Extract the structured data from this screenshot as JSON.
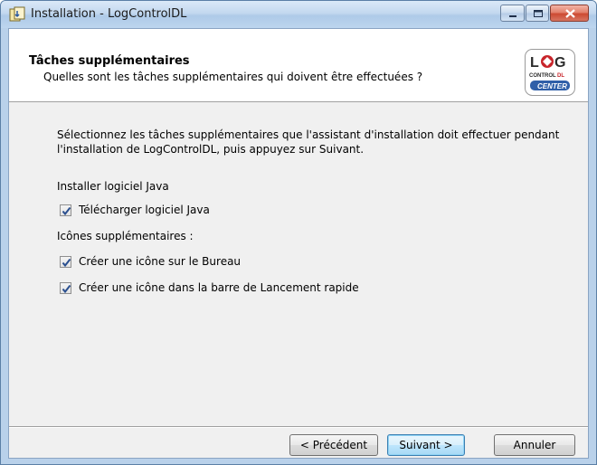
{
  "window": {
    "title": "Installation - LogControlDL",
    "controls": {
      "minimize": "minimize",
      "maximize": "maximize",
      "close": "close"
    }
  },
  "header": {
    "title": "Tâches supplémentaires",
    "subtitle": "Quelles sont les tâches supplémentaires qui doivent être effectuées ?",
    "logo": {
      "line1": "LOG",
      "line2": "CONTROL DL",
      "line3": "CENTER"
    }
  },
  "content": {
    "description": "Sélectionnez les tâches supplémentaires que l'assistant d'installation doit effectuer pendant l'installation de LogControlDL, puis appuyez sur Suivant.",
    "group_java": "Installer logiciel Java",
    "task_java": {
      "label": "Télécharger logiciel Java",
      "checked": true
    },
    "group_icons": "Icônes supplémentaires :",
    "task_desktop": {
      "label": "Créer une icône sur le Bureau",
      "checked": true
    },
    "task_quicklaunch": {
      "label": "Créer une icône dans la barre de Lancement rapide",
      "checked": true
    }
  },
  "buttons": {
    "previous": "< Précédent",
    "next": "Suivant >",
    "cancel": "Annuler"
  },
  "colors": {
    "titlebar": "#c3d8ef",
    "close": "#cd4a32",
    "logo_red": "#c8252b",
    "logo_blue": "#2f5fa8"
  }
}
